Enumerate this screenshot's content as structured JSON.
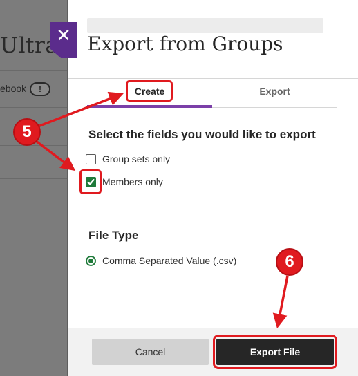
{
  "background": {
    "course_title": "Ultra",
    "gradebook_label": "ebook",
    "alert_symbol": "!"
  },
  "close_button": {
    "symbol": "✕",
    "icon": "close-icon"
  },
  "panel": {
    "title": "Export from Groups",
    "tabs": [
      {
        "label": "Create",
        "active": true
      },
      {
        "label": "Export",
        "active": false
      }
    ],
    "fields_heading": "Select the fields you would like to export",
    "options": [
      {
        "label": "Group sets only",
        "checked": false
      },
      {
        "label": "Members only",
        "checked": true
      }
    ],
    "file_type_heading": "File Type",
    "file_type_option": {
      "label": "Comma Separated Value (.csv)",
      "selected": true
    },
    "cancel_label": "Cancel",
    "export_label": "Export File"
  },
  "annotations": {
    "step_a": "5",
    "step_b": "6",
    "highlight_color": "#e01a1f"
  },
  "colors": {
    "accent_purple": "#7b3fa8",
    "close_tab": "#5b2c8c",
    "check_green": "#1f7a3a",
    "primary_button": "#262626"
  }
}
